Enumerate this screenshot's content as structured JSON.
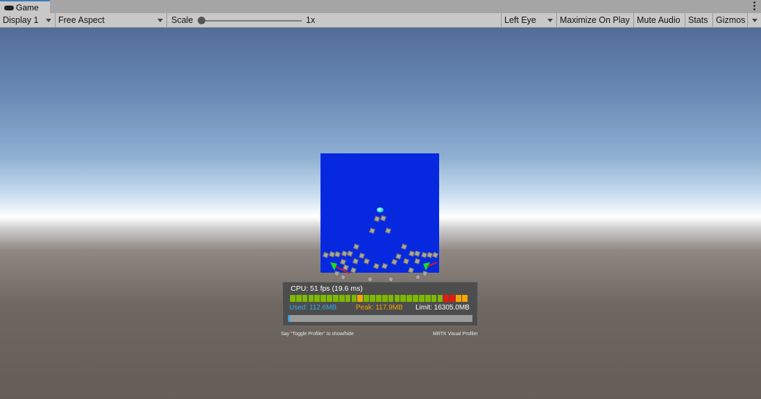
{
  "tab": {
    "label": "Game",
    "icon": "gamepad-icon"
  },
  "toolbar": {
    "display": "Display 1",
    "aspect": "Free Aspect",
    "scale_label": "Scale",
    "scale_value": "1x",
    "eye": "Left Eye",
    "maximize": "Maximize On Play",
    "mute": "Mute Audio",
    "stats": "Stats",
    "gizmos": "Gizmos"
  },
  "profiler": {
    "cpu": "CPU: 51 fps (19.6 ms)",
    "used": "Used: 112.6MB",
    "peak": "Peak: 117.9MB",
    "limit": "Limit: 16305.0MB",
    "memory_used_fraction": 0.007,
    "frame_bars": [
      "g",
      "g",
      "g",
      "g",
      "g",
      "g",
      "g",
      "g",
      "g",
      "g",
      "g",
      "o",
      "g",
      "g",
      "g",
      "g",
      "g",
      "g",
      "g",
      "g",
      "g",
      "g",
      "g",
      "g",
      "g",
      "r",
      "r",
      "o",
      "o"
    ],
    "hint": "Say \"Toggle Profiler\" to show/hide",
    "brand": "MRTK Visual Profiler"
  },
  "colors": {
    "panel_blue": "#0629e0",
    "bar_green": "#7fb800",
    "bar_orange": "#f5a600",
    "bar_red": "#e8170f",
    "used_text": "#38a8e8",
    "peak_text": "#f5a600",
    "tab_accent": "#3a79bb"
  }
}
